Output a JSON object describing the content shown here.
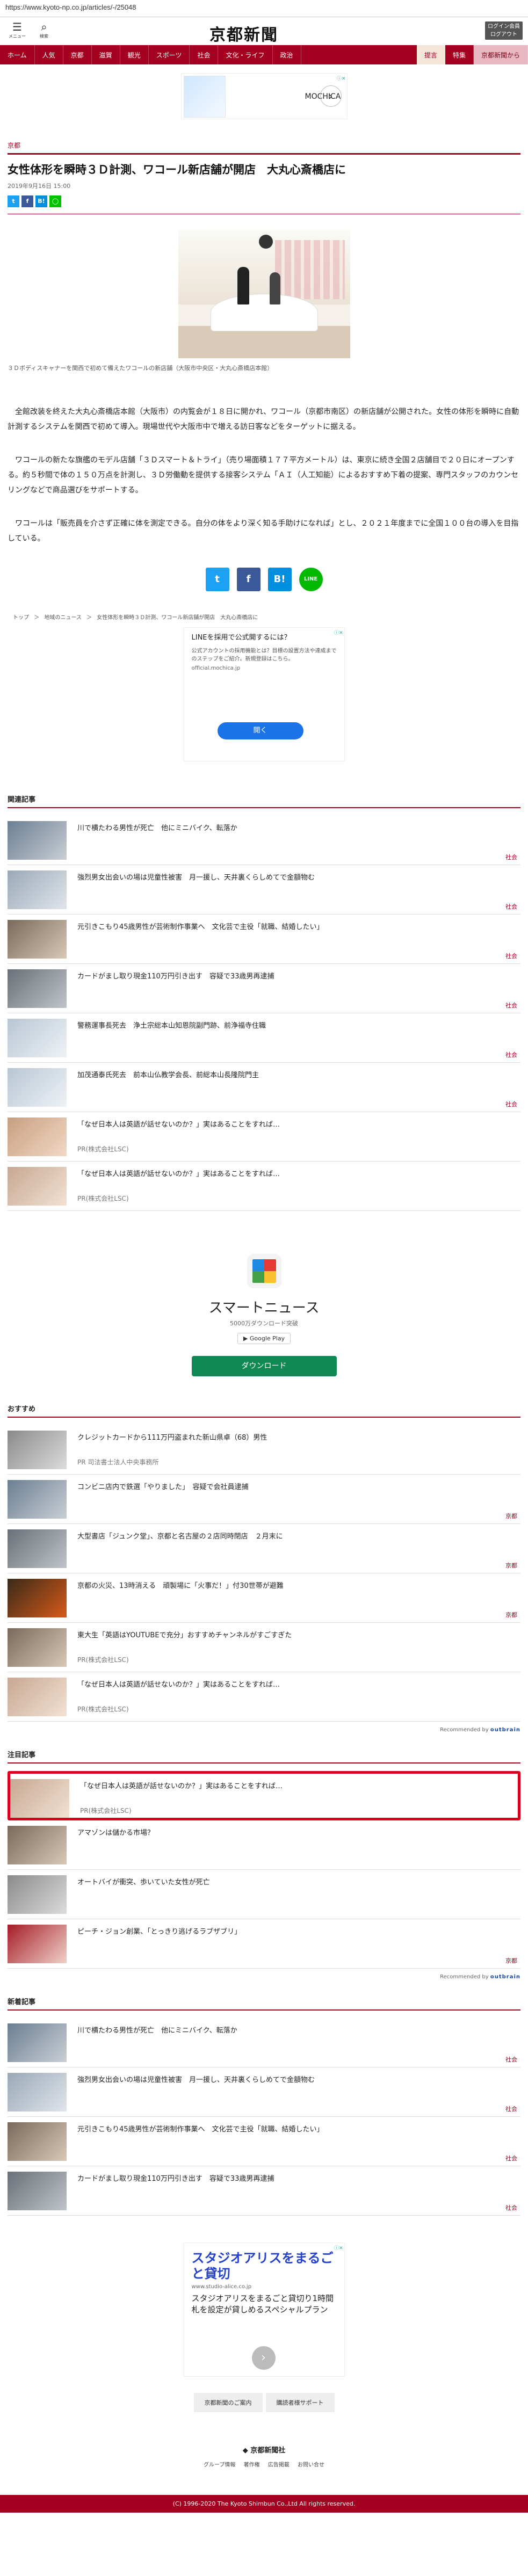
{
  "browser": {
    "url": "https://www.kyoto-np.co.jp/articles/-/25048"
  },
  "header": {
    "menu_label": "メニュー",
    "search_label": "検索",
    "logo": "京都新聞",
    "login_line1": "ログイン会員",
    "login_line2": "ログアウト"
  },
  "nav": {
    "items": [
      "ホーム",
      "人気",
      "京都",
      "滋賀",
      "観光",
      "スポーツ",
      "社会",
      "文化・ライフ",
      "政治"
    ],
    "right": [
      "提言",
      "特集",
      "京都新聞から"
    ]
  },
  "top_ad": {
    "name": "MOCHICA",
    "arrow": "›",
    "ad_mark": "ⓘ✕"
  },
  "article": {
    "section": "京都",
    "title": "女性体形を瞬時３Ｄ計測、ワコール新店舗が開店　大丸心斎橋店に",
    "date": "2019年9月16日 15:00",
    "photo_caption": "３Ｄボディスキャナーを関西で初めて備えたワコールの新店舗（大阪市中央区・大丸心斎橋店本館）",
    "paragraphs": [
      "　全館改装を終えた大丸心斎橋店本館（大阪市）の内覧会が１８日に開かれ、ワコール（京都市南区）の新店舗が公開された。女性の体形を瞬時に自動計測するシステムを関西で初めて導入。現場世代や大阪市中で増える訪日客などをターゲットに据える。",
      "　ワコールの新たな旗艦のモデル店舗「３Ｄスマート＆トライ」（売り場面積１７７平方メートル）は、東京に続き全国２店舗目で２０日にオープンする。約５秒間で体の１５０万点を計測し、３Ｄ労働動を提供する接客システム「ＡＩ（人工知能）によるおすすめ下着の提案、専門スタッフのカウンセリングなどで商品選びをサポートする。",
      "　ワコールは「販売員を介さず正確に体を測定できる。自分の体をより深く知る手助けになれば」とし、２０２１年度までに全国１００台の導入を目指している。"
    ]
  },
  "share": {
    "tw": "t",
    "fb": "f",
    "hb": "B!",
    "ln": "LINE"
  },
  "breadcrumb": [
    "トップ",
    "＞",
    "地域のニュース",
    "＞",
    "女性体形を瞬時３Ｄ計測、ワコール新店舗が開店　大丸心斎橋店に"
  ],
  "line_ad": {
    "title": "LINEを採用で公式開するには？",
    "text": "公式アカウントの採用機能とは？目標の設置方法や達成までのステップをご紹介。新規登録はこちら。",
    "domain": "official.mochica.jp",
    "open": "開く",
    "ad_mark": "ⓘ✕"
  },
  "related": {
    "title": "関連記事",
    "items": [
      {
        "title": "川で横たわる男性が死亡　他にミニバイク、転落か",
        "tag": "社会",
        "pr": ""
      },
      {
        "title": "強烈男女出会いの場は児童性被害　月一援し、天井裏くらしめてで金額物む",
        "tag": "社会",
        "pr": ""
      },
      {
        "title": "元引きこもり45歳男性が芸術制作事業へ　文化芸で主役「就職、結婚したい」",
        "tag": "社会",
        "pr": ""
      },
      {
        "title": "カードがまし取り現金110万円引き出す　容疑で33歳男再逮捕",
        "tag": "社会",
        "pr": ""
      },
      {
        "title": "警務運事長死去　浄土宗総本山知恩院副門跡、前浄福寺住職",
        "tag": "社会",
        "pr": ""
      },
      {
        "title": "加茂通泰氏死去　前本山仏教学会長、前総本山長隆院門主",
        "tag": "社会",
        "pr": ""
      },
      {
        "title": "「なぜ日本人は英語が話せないのか？」実はあることをすれば…",
        "tag": "",
        "pr": "PR(株式会社LSC)"
      },
      {
        "title": "「なぜ日本人は英語が話せないのか？」実はあることをすれば…",
        "tag": "",
        "pr": "PR(株式会社LSC)"
      }
    ]
  },
  "smartnews": {
    "name": "スマートニュース",
    "sub": "5000万ダウンロード突破",
    "store": "▶ Google Play",
    "download": "ダウンロード"
  },
  "recommend": {
    "title": "おすすめ",
    "items": [
      {
        "title": "クレジットカードから111万円盗まれた新山県卓（68）男性",
        "tag": "",
        "pr": "PR 司法書士法人中央事務所"
      },
      {
        "title": "コンビニ店内で鉄選「やりました」　容疑で会社員逮捕",
        "tag": "京都",
        "pr": ""
      },
      {
        "title": "大型書店「ジュンク堂」、京都と名古屋の２店同時閉店　２月末に",
        "tag": "京都",
        "pr": ""
      },
      {
        "title": "京都の火災、13時消える　頑製場に「火事だ！」付30世帯が避難",
        "tag": "京都",
        "pr": ""
      },
      {
        "title": "東大生「英語はYOUTUBEで充分」おすすめチャンネルがすごすぎた",
        "tag": "",
        "pr": "PR(株式会社LSC)"
      },
      {
        "title": "「なぜ日本人は英語が話せないのか？」実はあることをすれば…",
        "tag": "",
        "pr": "PR(株式会社LSC)"
      }
    ],
    "rec_label": "Recommended by",
    "rec_brand": "outbrain"
  },
  "featured": {
    "title": "注目記事",
    "items": [
      {
        "title": "「なぜ日本人は英語が話せないのか？」実はあることをすれば…",
        "tag": "",
        "pr": "PR(株式会社LSC)"
      },
      {
        "title": "アマゾンは儲かる市場？",
        "tag": "",
        "pr": ""
      },
      {
        "title": "オートバイが衝突、歩いていた女性が死亡",
        "tag": "",
        "pr": ""
      },
      {
        "title": "ピーチ・ジョン創業、「とっきり逃げるラブザブリ」",
        "tag": "京都",
        "pr": ""
      }
    ],
    "rec_label": "Recommended by",
    "rec_brand": "outbrain"
  },
  "latest": {
    "title": "新着記事",
    "items": [
      {
        "title": "川で横たわる男性が死亡　他にミニバイク、転落か",
        "tag": "社会",
        "pr": ""
      },
      {
        "title": "強烈男女出会いの場は児童性被害　月一援し、天井裏くらしめてで金額物む",
        "tag": "社会",
        "pr": ""
      },
      {
        "title": "元引きこもり45歳男性が芸術制作事業へ　文化芸で主役「就職、結婚したい」",
        "tag": "社会",
        "pr": ""
      },
      {
        "title": "カードがまし取り現金110万円引き出す　容疑で33歳男再逮捕",
        "tag": "社会",
        "pr": ""
      }
    ]
  },
  "bottom_ad": {
    "headline": "スタジオアリスをまるごと貸切",
    "domain": "www.studio-alice.co.jp",
    "text": "スタジオアリスをまるごと貸切り1時間札を設定が貸しめるスペシャルプラン",
    "arrow": "›",
    "ad_mark": "ⓘ✕"
  },
  "footer": {
    "buttons": [
      "京都新聞のご案内",
      "購読者様サポート"
    ],
    "logo": "◆ 京都新聞社",
    "links": [
      "グループ情報",
      "著作権",
      "広告掲載",
      "お問い合せ"
    ],
    "copyright": "(C) 1996-2020 The Kyoto Shimbun Co.,Ltd All rights reserved."
  }
}
